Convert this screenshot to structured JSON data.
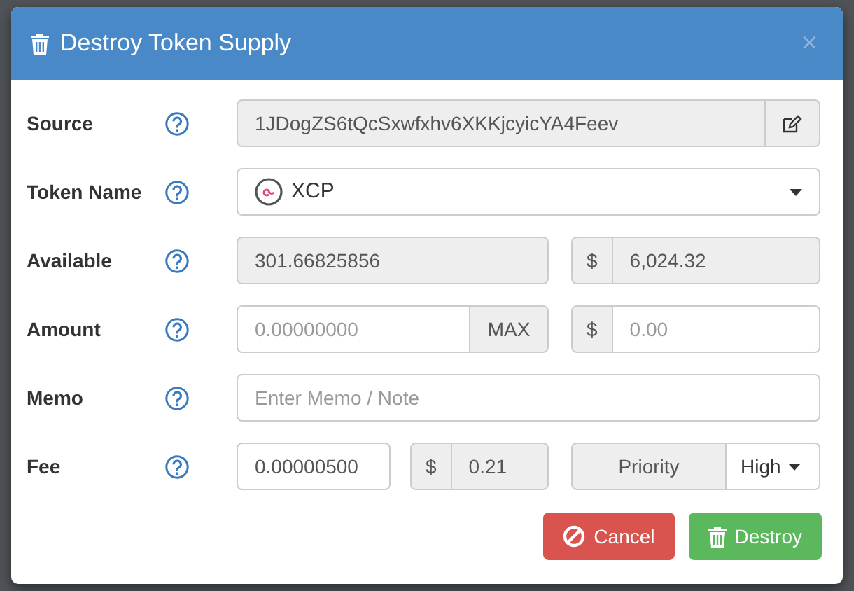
{
  "dialog": {
    "title": "Destroy Token Supply",
    "close": "×"
  },
  "fields": [
    {
      "label": "Source",
      "kind": "address",
      "value": "1JDogZS6tQcSxwfxhv6XKKjcyicYA4Feev",
      "disabled": true
    },
    {
      "label": "Token Name",
      "kind": "select",
      "value": "XCP"
    },
    {
      "label": "Available",
      "kind": "amount",
      "value": "301.66825856",
      "disabled": true,
      "currency": "$",
      "usd_value": "6,024.32",
      "usd_disabled": true
    },
    {
      "label": "Amount",
      "kind": "amount_max",
      "placeholder": "0.00000000",
      "addon": "MAX",
      "currency": "$",
      "usd_placeholder": "0.00",
      "usd_disabled": false
    },
    {
      "label": "Memo",
      "kind": "text",
      "placeholder": "Enter Memo / Note"
    },
    {
      "label": "Fee",
      "kind": "fee",
      "value": "0.00000500",
      "currency": "$",
      "usd_value": "0.21",
      "usd_disabled": true,
      "priority_label": "Priority",
      "priority": "High"
    }
  ],
  "buttons": [
    {
      "label": "Cancel",
      "kind": "cancel"
    },
    {
      "label": "Destroy",
      "kind": "destroy"
    }
  ]
}
